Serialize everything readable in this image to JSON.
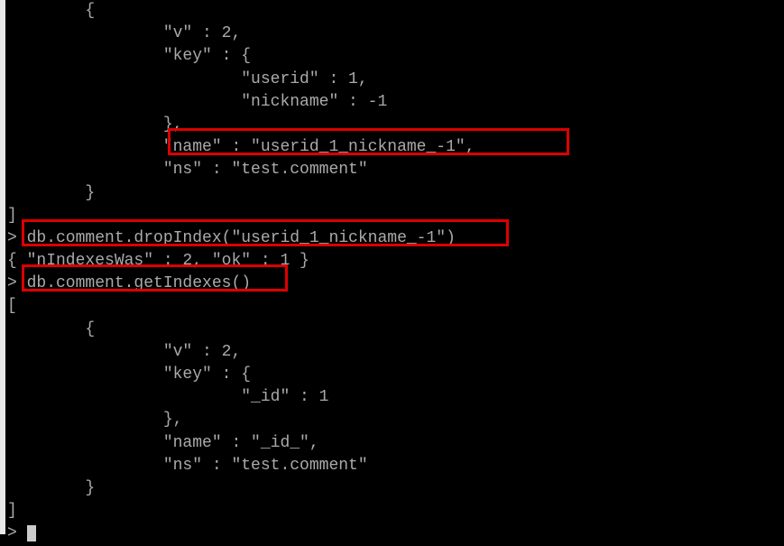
{
  "lines": {
    "l0": "        {",
    "l1": "                \"v\" : 2,",
    "l2": "                \"key\" : {",
    "l3": "                        \"userid\" : 1,",
    "l4": "                        \"nickname\" : -1",
    "l5": "                },",
    "l6": "                \"name\" : \"userid_1_nickname_-1\",",
    "l7": "                \"ns\" : \"test.comment\"",
    "l8": "        }",
    "l9": "]",
    "l10": "> db.comment.dropIndex(\"userid_1_nickname_-1\")",
    "l11": "{ \"nIndexesWas\" : 2, \"ok\" : 1 }",
    "l12": "> db.comment.getIndexes()",
    "l13": "[",
    "l14": "        {",
    "l15": "                \"v\" : 2,",
    "l16": "                \"key\" : {",
    "l17": "                        \"_id\" : 1",
    "l18": "                },",
    "l19": "                \"name\" : \"_id_\",",
    "l20": "                \"ns\" : \"test.comment\"",
    "l21": "        }",
    "l22": "]",
    "l23": "> "
  }
}
